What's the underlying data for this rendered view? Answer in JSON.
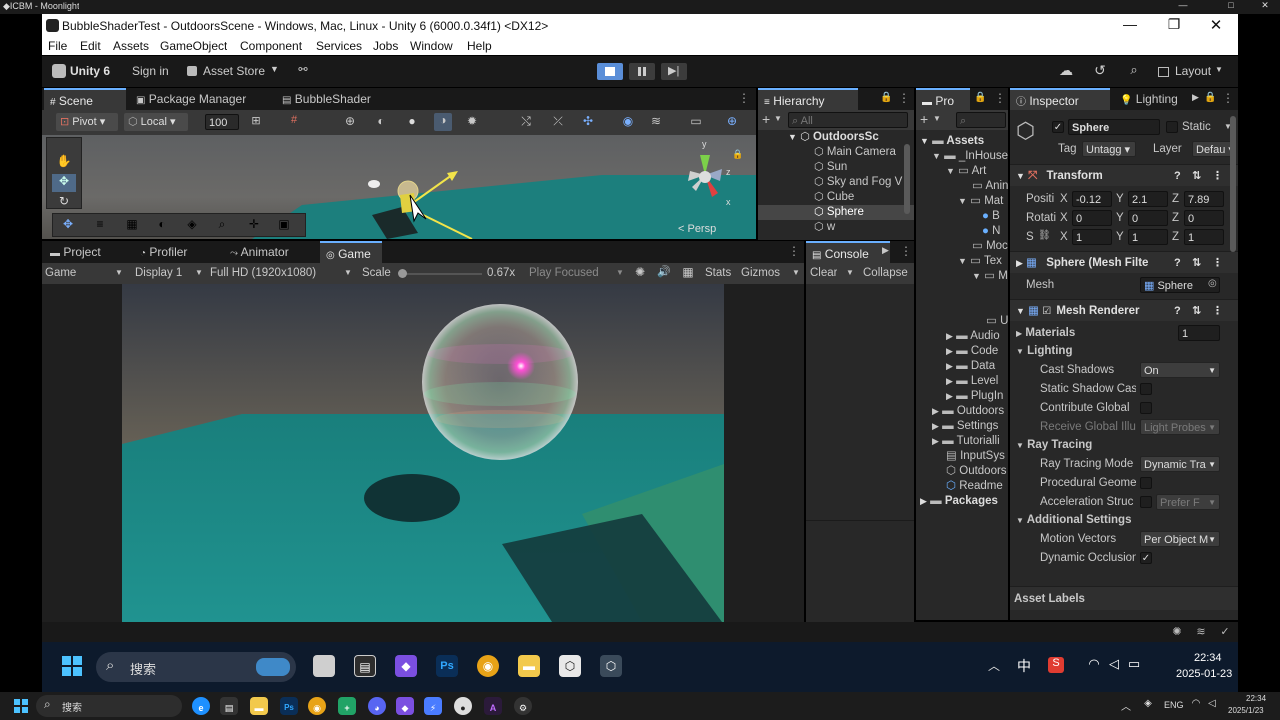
{
  "host": {
    "title": "◆ICBM - Moonlight",
    "min_icon": "minimize-icon",
    "max_icon": "maximize-icon",
    "close_icon": "close-icon"
  },
  "window": {
    "title": "BubbleShaderTest - OutdoorsScene - Windows, Mac, Linux - Unity 6 (6000.0.34f1) <DX12>"
  },
  "menu": [
    "File",
    "Edit",
    "Assets",
    "GameObject",
    "Component",
    "Services",
    "Jobs",
    "Window",
    "Help"
  ],
  "toolbar": {
    "unity_label": "Unity 6",
    "sign_in": "Sign in",
    "asset_store": "Asset Store",
    "layout": "Layout"
  },
  "scene_tabs": [
    "Scene",
    "Package Manager",
    "BubbleShader"
  ],
  "scene_toolbar": {
    "pivot": "Pivot",
    "local": "Local",
    "grid_size": "100",
    "persp": "< Persp"
  },
  "gizmo_axes": {
    "y": "y",
    "z": "z",
    "x": "x"
  },
  "bottom_tabs": [
    "Project",
    "Profiler",
    "Animator",
    "Game"
  ],
  "game_toolbar": {
    "mode": "Game",
    "display": "Display 1",
    "resolution": "Full HD (1920x1080)",
    "scale_label": "Scale",
    "scale_value": "0.67x",
    "play_focused": "Play Focused",
    "stats": "Stats",
    "gizmos": "Gizmos"
  },
  "console": {
    "tab": "Console",
    "clear": "Clear",
    "collapse": "Collapse"
  },
  "hierarchy": {
    "tab": "Hierarchy",
    "search_placeholder": "All",
    "scene": "OutdoorsSc",
    "items": [
      "Main Camera",
      "Sun",
      "Sky and Fog V",
      "Cube",
      "Sphere",
      "w"
    ]
  },
  "project": {
    "tab": "Pro",
    "root": "Assets",
    "items": [
      "_InHouse",
      "Art",
      "Anin",
      "Mat",
      "B",
      "N",
      "Moc",
      "Tex",
      "M",
      "U",
      "Audio",
      "Code",
      "Data",
      "Level",
      "PlugIn",
      "Outdoors",
      "Settings",
      "Tutorialli",
      "InputSys",
      "Outdoors",
      "Readme"
    ],
    "packages": "Packages"
  },
  "inspector": {
    "tab": "Inspector",
    "lighting_tab": "Lighting",
    "object_name": "Sphere",
    "static_label": "Static",
    "tag_label": "Tag",
    "tag_value": "Untagg",
    "layer_label": "Layer",
    "layer_value": "Defau",
    "transform": {
      "header": "Transform",
      "position_label": "Positi",
      "rotation_label": "Rotati",
      "scale_label": "S",
      "axis_x": "X",
      "axis_y": "Y",
      "axis_z": "Z",
      "position": [
        "-0.12",
        "2.1",
        "7.89"
      ],
      "rotation": [
        "0",
        "0",
        "0"
      ],
      "scale": [
        "1",
        "1",
        "1"
      ]
    },
    "mesh_filter": {
      "header": "Sphere (Mesh Filte",
      "mesh_label": "Mesh",
      "mesh_value": "Sphere"
    },
    "mesh_renderer": {
      "header": "Mesh Renderer",
      "materials_label": "Materials",
      "materials_count": "1",
      "lighting_label": "Lighting",
      "cast_shadows_label": "Cast Shadows",
      "cast_shadows_value": "On",
      "static_shadow_label": "Static Shadow Cas",
      "contribute_gi_label": "Contribute Global",
      "receive_gi_label": "Receive Global Illu",
      "receive_gi_value": "Light Probes",
      "ray_tracing_label": "Ray Tracing",
      "ray_tracing_mode_label": "Ray Tracing Mode",
      "ray_tracing_mode_value": "Dynamic Tra",
      "procedural_label": "Procedural Geome",
      "accel_label": "Acceleration Struc",
      "accel_value": "Prefer F",
      "additional_label": "Additional Settings",
      "motion_vectors_label": "Motion Vectors",
      "motion_vectors_value": "Per Object M",
      "dynamic_occlusion_label": "Dynamic Occlusion"
    },
    "asset_labels": "Asset Labels"
  },
  "win_taskbar": {
    "search": "搜索",
    "ime": "中",
    "time": "22:34",
    "date": "2025-01-23"
  },
  "host_taskbar": {
    "search": "搜索",
    "lang": "ENG",
    "time": "22:34",
    "date": "2025/1/23"
  },
  "colors": {
    "accent": "#6ab0ff",
    "editor_bg": "#282828",
    "teal_floor": "#1f8a85"
  }
}
